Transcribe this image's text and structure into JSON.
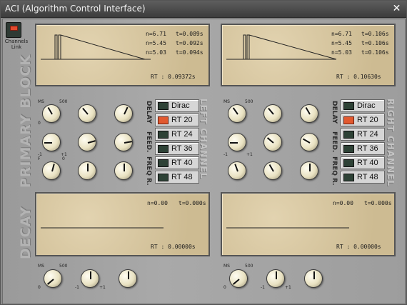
{
  "window": {
    "title": "ACI (Algorithm Control Interface)",
    "close_glyph": "✕"
  },
  "channels_link": {
    "label": "Channels Link",
    "active": true,
    "icon": "led-icon"
  },
  "sections": {
    "primary_block": "PRIMARY BLOCK",
    "decay": "DECAY"
  },
  "left_channel": {
    "name": "LEFT CHANNEL",
    "primary_display": {
      "readouts": [
        {
          "n": "n=6.71",
          "t": "t=0.089s"
        },
        {
          "n": "n=5.45",
          "t": "t=0.092s"
        },
        {
          "n": "n=5.03",
          "t": "t=0.094s"
        }
      ],
      "rt": "RT : 0.09372s"
    },
    "decay_display": {
      "readouts": [
        {
          "n": "n=0.00",
          "t": "t=0.000s"
        }
      ],
      "rt": "RT : 0.00000s"
    },
    "presets": [
      {
        "label": "Dirac",
        "active": false
      },
      {
        "label": "RT 20",
        "active": true
      },
      {
        "label": "RT 24",
        "active": false
      },
      {
        "label": "RT 36",
        "active": false
      },
      {
        "label": "RT 40",
        "active": false
      },
      {
        "label": "RT 48",
        "active": false
      }
    ]
  },
  "right_channel": {
    "name": "RIGHT CHANNEL",
    "primary_display": {
      "readouts": [
        {
          "n": "n=6.71",
          "t": "t=0.106s"
        },
        {
          "n": "n=5.45",
          "t": "t=0.106s"
        },
        {
          "n": "n=5.03",
          "t": "t=0.106s"
        }
      ],
      "rt": "RT : 0.10630s"
    },
    "decay_display": {
      "readouts": [
        {
          "n": "n=0.00",
          "t": "t=0.000s"
        }
      ],
      "rt": "RT : 0.00000s"
    },
    "presets": [
      {
        "label": "Dirac",
        "active": false
      },
      {
        "label": "RT 20",
        "active": true
      },
      {
        "label": "RT 24",
        "active": false
      },
      {
        "label": "RT 36",
        "active": false
      },
      {
        "label": "RT 40",
        "active": false
      },
      {
        "label": "RT 48",
        "active": false
      }
    ]
  },
  "row_labels": {
    "delay": "DELAY",
    "feed": "FEED.",
    "freq": "FREQ R."
  },
  "knob_labels": {
    "delay_ms": "MS",
    "delay_max": "500",
    "delay_min": "0",
    "delay_side": "1000",
    "feed_min": "-1",
    "feed_zero": "0",
    "feed_max": "+1",
    "freq_high": "HIGH",
    "freq_f": "F",
    "freq_low": "LOW",
    "freq_zero": "0"
  }
}
